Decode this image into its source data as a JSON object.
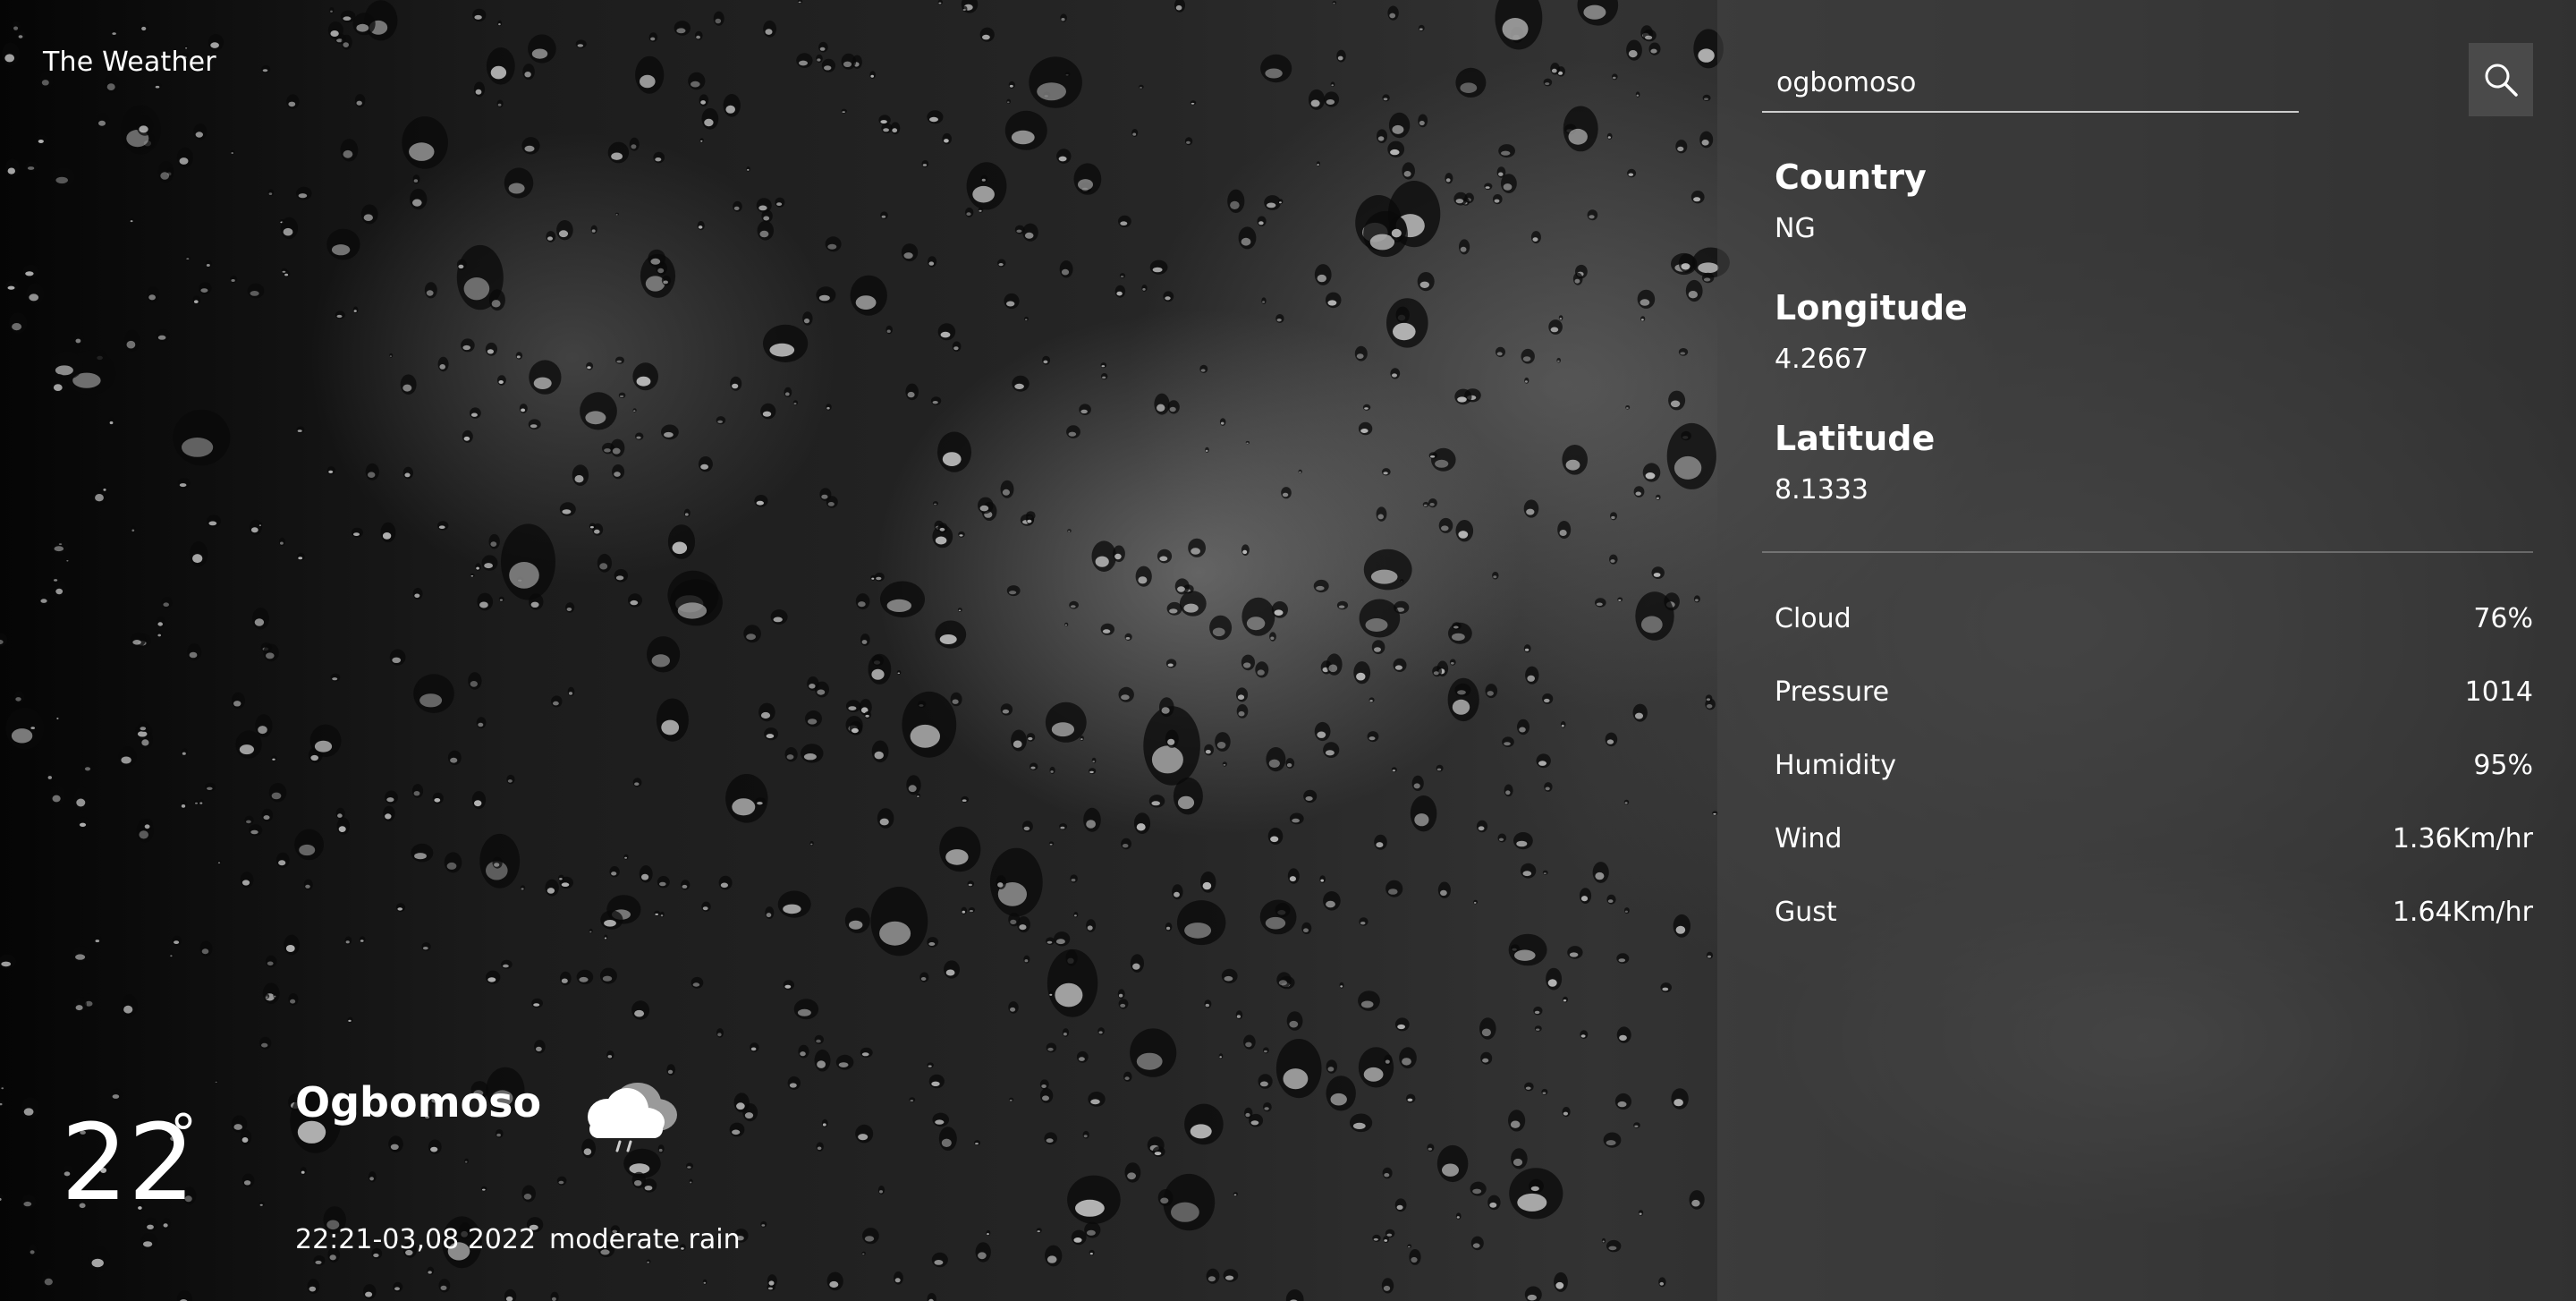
{
  "brand": {
    "title": "The Weather"
  },
  "current": {
    "temperature": "22",
    "degree_symbol": "°",
    "city": "Ogbomoso",
    "datetime": "22:21-03,08 2022",
    "condition": "moderate rain",
    "condition_icon": "cloud-rain-icon"
  },
  "search": {
    "value": "ogbomoso",
    "icon": "search-icon"
  },
  "location": {
    "country_label": "Country",
    "country_value": "NG",
    "longitude_label": "Longitude",
    "longitude_value": "4.2667",
    "latitude_label": "Latitude",
    "latitude_value": "8.1333"
  },
  "metrics": [
    {
      "label": "Cloud",
      "value": "76%"
    },
    {
      "label": "Pressure",
      "value": "1014"
    },
    {
      "label": "Humidity",
      "value": "95%"
    },
    {
      "label": "Wind",
      "value": "1.36Km/hr"
    },
    {
      "label": "Gust",
      "value": "1.64Km/hr"
    }
  ],
  "colors": {
    "panel": "#464646",
    "text": "#ffffff",
    "search_button": "#4a4a4a"
  }
}
